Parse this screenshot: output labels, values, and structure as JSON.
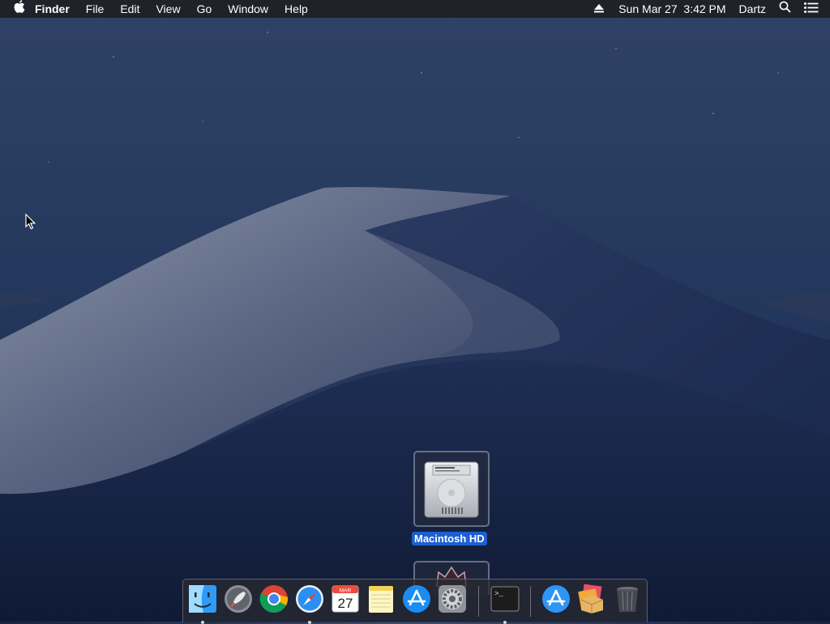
{
  "menubar": {
    "apple_icon": "apple-logo-icon",
    "app_name": "Finder",
    "menus": [
      "File",
      "Edit",
      "View",
      "Go",
      "Window",
      "Help"
    ],
    "eject_icon": "eject-icon",
    "datetime": "Sun Mar 27  3:42 PM",
    "user": "Dartz",
    "search_icon": "spotlight-search-icon",
    "notifications_icon": "notification-center-icon"
  },
  "desktop": {
    "icons": [
      {
        "label": "Macintosh HD",
        "icon": "hard-drive-icon",
        "selected": true
      },
      {
        "label": "",
        "icon": "disk-image-icon",
        "selected": false
      }
    ]
  },
  "dock": {
    "apps": [
      {
        "name": "Finder",
        "icon": "finder-icon",
        "running": true
      },
      {
        "name": "Launchpad",
        "icon": "launchpad-icon",
        "running": false
      },
      {
        "name": "Google Chrome",
        "icon": "chrome-icon",
        "running": false
      },
      {
        "name": "Safari",
        "icon": "safari-icon",
        "running": true
      },
      {
        "name": "Calendar",
        "icon": "calendar-icon",
        "running": false,
        "month": "MAR",
        "day": "27"
      },
      {
        "name": "Notes",
        "icon": "notes-icon",
        "running": false
      },
      {
        "name": "App Store",
        "icon": "app-store-icon",
        "running": false
      },
      {
        "name": "System Preferences",
        "icon": "system-preferences-icon",
        "running": false
      },
      {
        "name": "Terminal",
        "icon": "terminal-icon",
        "running": true,
        "prompt": ">_"
      },
      {
        "name": "Applications",
        "icon": "applications-folder-icon",
        "running": false
      },
      {
        "name": "Installer Packages",
        "icon": "packages-stack-icon",
        "running": false
      },
      {
        "name": "Trash",
        "icon": "trash-icon",
        "running": false
      }
    ]
  },
  "colors": {
    "selection_blue": "#1e5fd1",
    "menubar_bg": "#1e1e20"
  }
}
